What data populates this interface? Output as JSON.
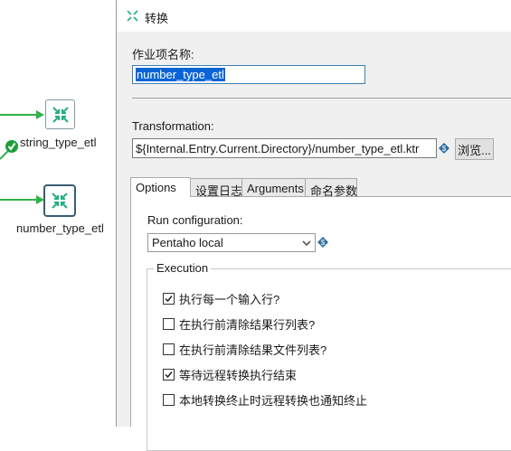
{
  "canvas": {
    "steps": [
      {
        "name": "string_type_etl",
        "icon": "job-transformation-icon",
        "status": "success"
      },
      {
        "name": "number_type_etl",
        "icon": "job-transformation-icon",
        "selected": true
      }
    ],
    "hop_color": "#2fb24a",
    "success_color": "#1e9e3a"
  },
  "dialog": {
    "title": "转换",
    "name_label": "作业项名称:",
    "name_value": "number_type_etl",
    "transformation_label": "Transformation:",
    "transformation_path": "${Internal.Entry.Current.Directory}/number_type_etl.ktr",
    "browse_label": "浏览...",
    "tabs": [
      {
        "label": "Options",
        "active": true
      },
      {
        "label": "设置日志"
      },
      {
        "label": "Arguments"
      },
      {
        "label": "命名参数"
      }
    ],
    "options": {
      "run_config_label": "Run configuration:",
      "run_config_value": "Pentaho local",
      "execution_label": "Execution",
      "checkboxes": [
        {
          "label": "执行每一个输入行?",
          "checked": true
        },
        {
          "label": "在执行前清除结果行列表?",
          "checked": false
        },
        {
          "label": "在执行前清除结果文件列表?",
          "checked": false
        },
        {
          "label": "等待远程转换执行结束",
          "checked": true
        },
        {
          "label": "本地转换终止时远程转换也通知终止",
          "checked": false
        }
      ]
    }
  }
}
